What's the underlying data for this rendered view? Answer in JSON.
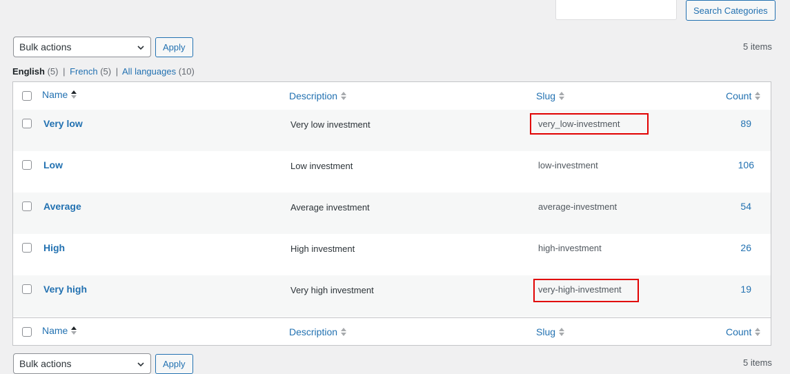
{
  "search": {
    "placeholder": "",
    "button_label": "Search Categories"
  },
  "bulk": {
    "selected": "Bulk actions",
    "apply_label": "Apply"
  },
  "items_count": "5 items",
  "languages": [
    {
      "label": "English",
      "count": "(5)"
    },
    {
      "label": "French",
      "count": "(5)"
    },
    {
      "label": "All languages",
      "count": "(10)"
    }
  ],
  "language_separator": "|",
  "columns": {
    "name": "Name",
    "description": "Description",
    "slug": "Slug",
    "count": "Count"
  },
  "rows": [
    {
      "name": "Very low",
      "description": "Very low investment",
      "slug": "very_low-investment",
      "count": "89"
    },
    {
      "name": "Low",
      "description": "Low investment",
      "slug": "low-investment",
      "count": "106"
    },
    {
      "name": "Average",
      "description": "Average investment",
      "slug": "average-investment",
      "count": "54"
    },
    {
      "name": "High",
      "description": "High investment",
      "slug": "high-investment",
      "count": "26"
    },
    {
      "name": "Very high",
      "description": "Very high investment",
      "slug": "very-high-investment",
      "count": "19"
    }
  ],
  "highlight_color": "#e10000",
  "link_color": "#2271b1"
}
